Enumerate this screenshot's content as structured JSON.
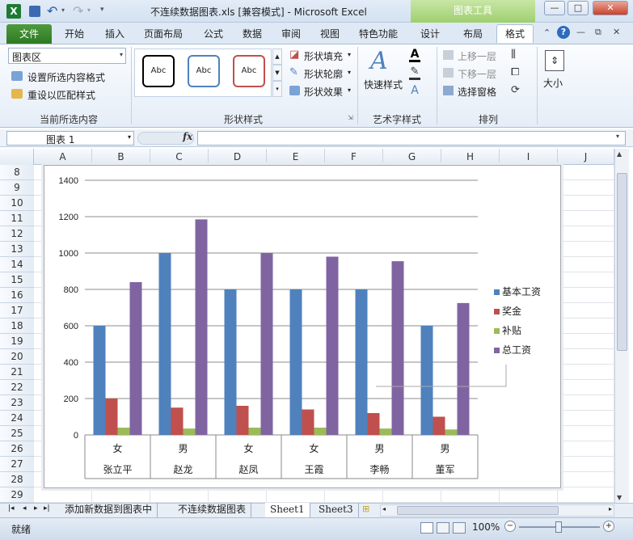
{
  "window": {
    "title": "不连续数据图表.xls  [兼容模式] - Microsoft Excel",
    "chart_tools": "图表工具"
  },
  "tabs": [
    "开始",
    "插入",
    "页面布局",
    "公式",
    "数据",
    "审阅",
    "视图",
    "特色功能",
    "设计",
    "布局",
    "格式"
  ],
  "file_tab": "文件",
  "ribbon": {
    "current_selection": {
      "dropdown_value": "图表区",
      "format_selection": "设置所选内容格式",
      "reset_style": "重设以匹配样式",
      "label": "当前所选内容"
    },
    "shape_styles": {
      "samples": [
        "Abc",
        "Abc",
        "Abc"
      ],
      "fill": "形状填充",
      "outline": "形状轮廓",
      "effect": "形状效果",
      "label": "形状样式"
    },
    "wordart": {
      "quick_style": "快速样式",
      "label": "艺术字样式"
    },
    "arrange": {
      "bring_forward": "上移一层",
      "send_backward": "下移一层",
      "selection_pane": "选择窗格",
      "label": "排列"
    },
    "size": {
      "label": "大小"
    }
  },
  "formula_bar": {
    "name_box": "图表 1",
    "fx": "fx",
    "value": ""
  },
  "columns": [
    "A",
    "B",
    "C",
    "D",
    "E",
    "F",
    "G",
    "H",
    "I",
    "J"
  ],
  "rows": [
    "8",
    "9",
    "10",
    "11",
    "12",
    "13",
    "14",
    "15",
    "16",
    "17",
    "18",
    "19",
    "20",
    "21",
    "22",
    "23",
    "24",
    "25",
    "26",
    "27",
    "28",
    "29"
  ],
  "sheet_tabs": [
    "添加新数据到图表中",
    "不连续数据图表",
    "Sheet1",
    "Sheet3"
  ],
  "status": {
    "ready": "就绪",
    "zoom": "100%"
  },
  "colors": {
    "series1": "#4f81bd",
    "series2": "#c0504d",
    "series3": "#9bbb59",
    "series4": "#8064a2"
  },
  "chart_data": {
    "type": "bar",
    "categories": [
      [
        "女",
        "张立平"
      ],
      [
        "男",
        "赵龙"
      ],
      [
        "女",
        "赵凤"
      ],
      [
        "女",
        "王霞"
      ],
      [
        "男",
        "李畅"
      ],
      [
        "男",
        "董军"
      ]
    ],
    "series": [
      {
        "name": "基本工资",
        "values": [
          600,
          1000,
          800,
          800,
          800,
          600
        ]
      },
      {
        "name": "奖金",
        "values": [
          200,
          150,
          160,
          140,
          120,
          100
        ]
      },
      {
        "name": "补贴",
        "values": [
          40,
          35,
          40,
          40,
          35,
          30
        ]
      },
      {
        "name": "总工资",
        "values": [
          840,
          1185,
          1000,
          980,
          955,
          725
        ]
      }
    ],
    "ylim": [
      0,
      1400
    ],
    "yticks": [
      "0",
      "200",
      "400",
      "600",
      "800",
      "1000",
      "1200",
      "1400"
    ],
    "grid": true,
    "legend_position": "right"
  }
}
